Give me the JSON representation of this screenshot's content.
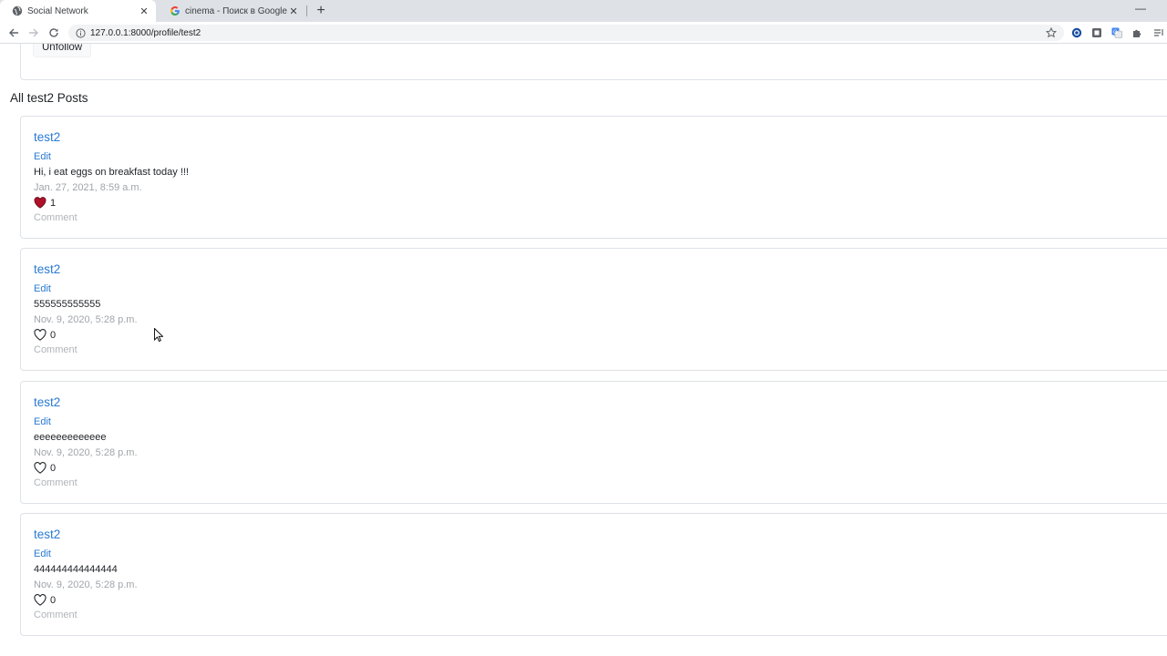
{
  "browser": {
    "tabs": [
      {
        "title": "Social Network",
        "icon": "globe-icon",
        "active": true
      },
      {
        "title": "cinema - Поиск в Google",
        "icon": "google-icon",
        "active": false
      }
    ],
    "url": "127.0.0.1:8000/profile/test2"
  },
  "profile": {
    "unfollow_label": "Unfollow"
  },
  "section_title": "All test2 Posts",
  "posts": [
    {
      "author": "test2",
      "edit_label": "Edit",
      "body": "Hi, i eat eggs on breakfast today !!!",
      "date": "Jan. 27, 2021, 8:59 a.m.",
      "likes": "1",
      "liked": true,
      "comment_label": "Comment"
    },
    {
      "author": "test2",
      "edit_label": "Edit",
      "body": "555555555555",
      "date": "Nov. 9, 2020, 5:28 p.m.",
      "likes": "0",
      "liked": false,
      "comment_label": "Comment"
    },
    {
      "author": "test2",
      "edit_label": "Edit",
      "body": "eeeeeeeeeeeee",
      "date": "Nov. 9, 2020, 5:28 p.m.",
      "likes": "0",
      "liked": false,
      "comment_label": "Comment"
    },
    {
      "author": "test2",
      "edit_label": "Edit",
      "body": "444444444444444",
      "date": "Nov. 9, 2020, 5:28 p.m.",
      "likes": "0",
      "liked": false,
      "comment_label": "Comment"
    }
  ],
  "colors": {
    "link": "#2a7ad2",
    "liked_heart": "#b0102a",
    "muted_text": "#a0a5aa"
  }
}
